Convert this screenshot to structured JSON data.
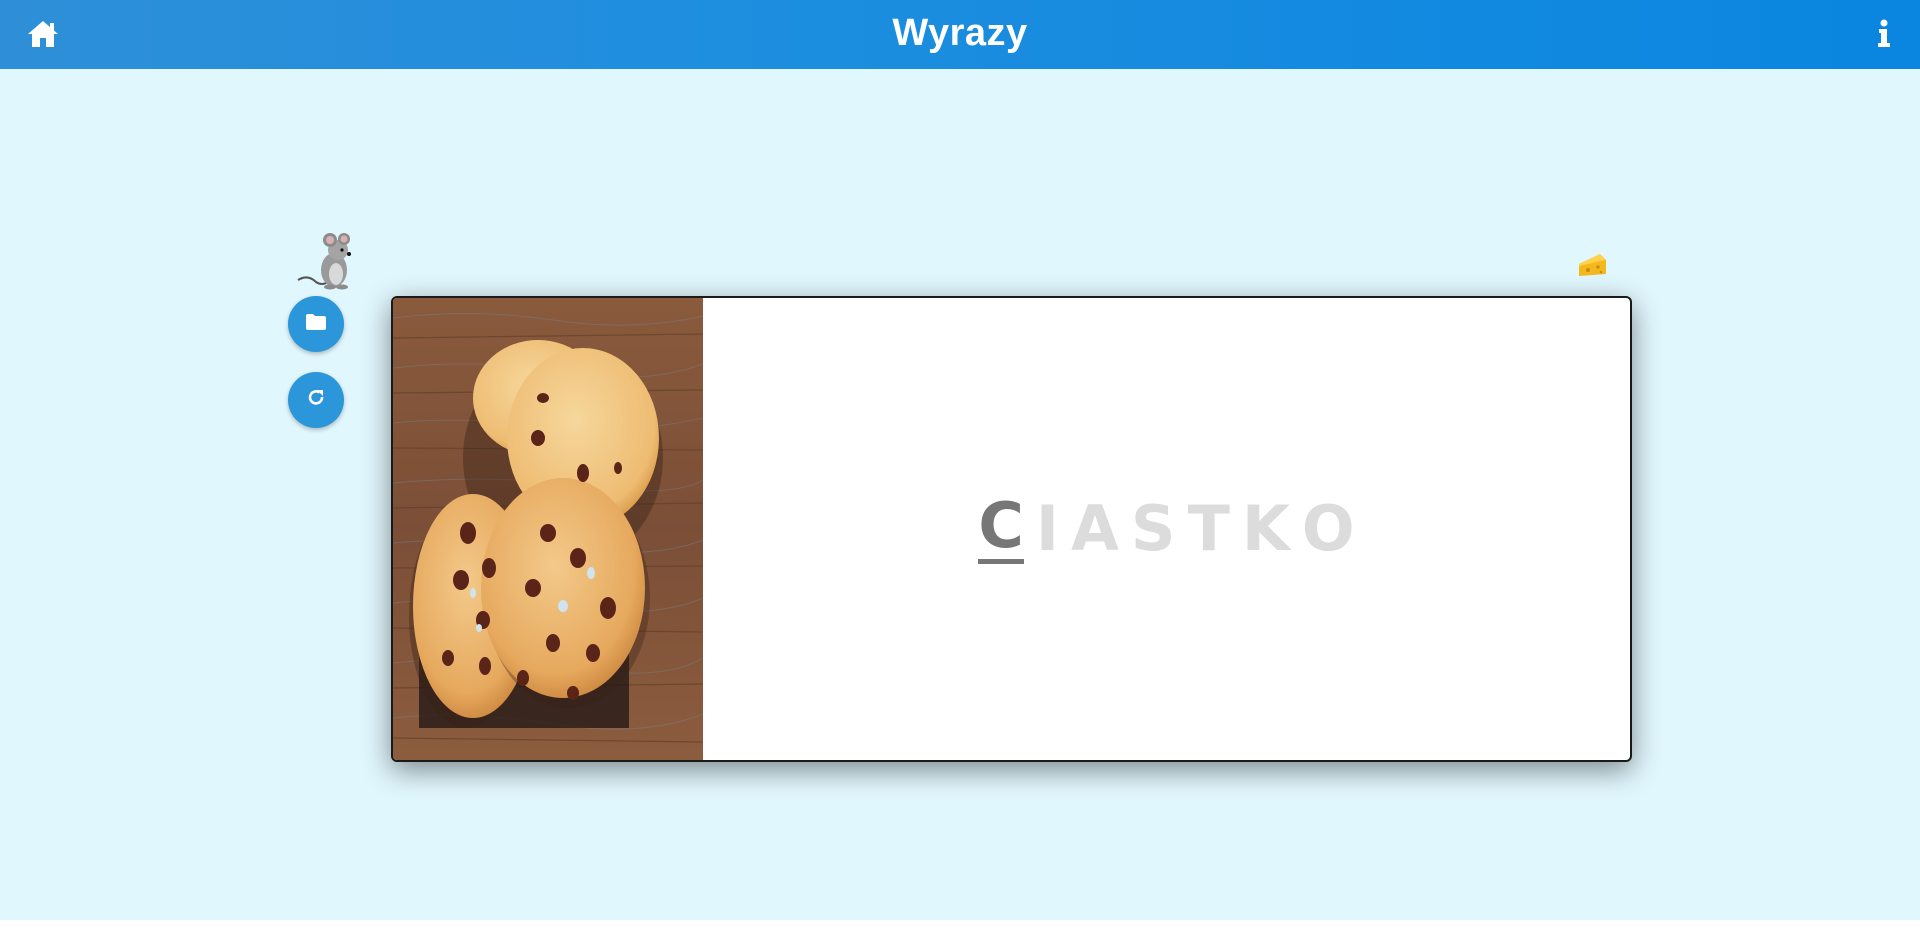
{
  "app": {
    "title": "Wyrazy",
    "accent": "#1d8edf",
    "background": "#e0f7fd"
  },
  "topbar": {
    "home_icon": "home-icon",
    "info_icon": "info-icon"
  },
  "sidebar": {
    "buttons": [
      {
        "icon": "folder-icon"
      },
      {
        "icon": "refresh-icon"
      }
    ]
  },
  "decorations": {
    "mouse": "mouse-icon",
    "cheese": "cheese-icon"
  },
  "card": {
    "image": "cookies-image",
    "letters": [
      "C",
      "I",
      "A",
      "S",
      "T",
      "K",
      "O"
    ],
    "active_index": 0,
    "active_color": "#777777",
    "inactive_color": "#dcdcdc"
  }
}
